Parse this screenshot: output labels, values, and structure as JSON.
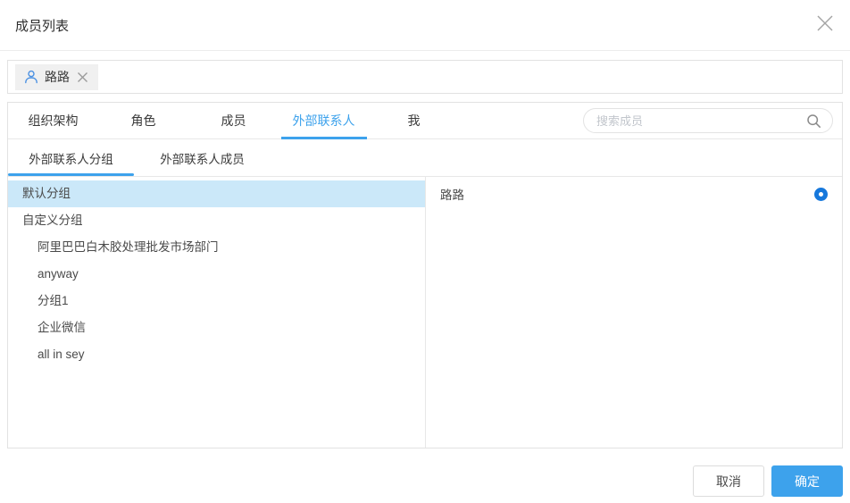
{
  "dialog": {
    "title": "成员列表"
  },
  "selected_tags": [
    {
      "name": "路路"
    }
  ],
  "tabs": [
    {
      "label": "组织架构",
      "active": false
    },
    {
      "label": "角色",
      "active": false
    },
    {
      "label": "成员",
      "active": false
    },
    {
      "label": "外部联系人",
      "active": true
    },
    {
      "label": "我",
      "active": false
    }
  ],
  "search": {
    "placeholder": "搜索成员"
  },
  "subtabs": [
    {
      "label": "外部联系人分组",
      "active": true
    },
    {
      "label": "外部联系人成员",
      "active": false
    }
  ],
  "groups": [
    {
      "label": "默认分组",
      "indent": 0,
      "selected": true
    },
    {
      "label": "自定义分组",
      "indent": 0,
      "selected": false
    },
    {
      "label": "阿里巴巴白木胶处理批发市场部门",
      "indent": 1,
      "selected": false
    },
    {
      "label": "anyway",
      "indent": 1,
      "selected": false
    },
    {
      "label": "分组1",
      "indent": 1,
      "selected": false
    },
    {
      "label": "企业微信",
      "indent": 1,
      "selected": false
    },
    {
      "label": "all in sey",
      "indent": 1,
      "selected": false
    }
  ],
  "members": [
    {
      "name": "路路",
      "selected": true
    }
  ],
  "footer": {
    "cancel_label": "取消",
    "confirm_label": "确定"
  },
  "colors": {
    "accent": "#3DA2EC",
    "radio": "#1678DC",
    "selected_row_bg": "#CBE8F9"
  }
}
